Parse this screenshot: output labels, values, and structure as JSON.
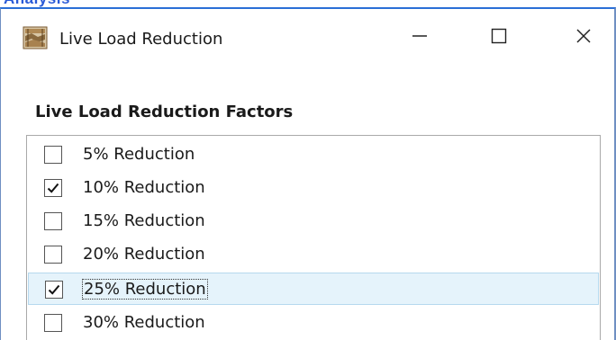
{
  "background": {
    "partial_text": "Analysis"
  },
  "window": {
    "title": "Live Load Reduction",
    "controls": {
      "minimize_icon": "minimize-icon",
      "maximize_icon": "maximize-icon",
      "close_icon": "close-icon"
    }
  },
  "section": {
    "label": "Live Load Reduction Factors"
  },
  "factors": [
    {
      "label": "5% Reduction",
      "checked": false,
      "selected": false
    },
    {
      "label": "10% Reduction",
      "checked": true,
      "selected": false
    },
    {
      "label": "15% Reduction",
      "checked": false,
      "selected": false
    },
    {
      "label": "20% Reduction",
      "checked": false,
      "selected": false
    },
    {
      "label": "25% Reduction",
      "checked": true,
      "selected": true
    },
    {
      "label": "30% Reduction",
      "checked": false,
      "selected": false
    }
  ],
  "colors": {
    "title_border": "#2a6fd6",
    "selection_bg": "#e5f3fb",
    "selection_border": "#b6d9ee"
  }
}
